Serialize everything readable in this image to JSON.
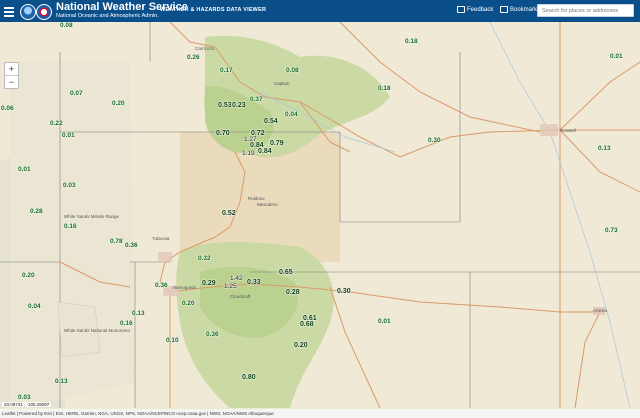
{
  "header": {
    "title": "National Weather Service",
    "subtitle": "National Oceanic and Atmospheric Admin.",
    "viewer_title": "WEATHER & HAZARDS DATA VIEWER",
    "feedback_label": "Feedback",
    "bookmark_label": "Bookmark",
    "search_placeholder": "Search for places or addresses"
  },
  "map": {
    "zoom_in": "+",
    "zoom_out": "−",
    "coordinates": "33.08731 , -105.29297",
    "attribution": "Leaflet | Powered by Esri | Esri, HERE, Garmin, NGA, USGS, NPS, NOAA/NCEP/NCO ncep.noaa.gov | NWS; NOAA/NWS Albuquerque",
    "place_labels": [
      "Carrizozo",
      "Capitan",
      "Roswell",
      "Ruidoso",
      "Mescalero",
      "White Sands Missile Range",
      "Tularosa",
      "Alamogordo",
      "White Sands National Monument",
      "Cloudcroft",
      "Artesia"
    ],
    "precip_values": [
      "0.08",
      "0.07",
      "0.06",
      "0.20",
      "0.22",
      "0.01",
      "0.17",
      "0.08",
      "0.18",
      "0.01",
      "0.26",
      "0.37",
      "0.53",
      "0.23",
      "0.54",
      "0.18",
      "0.04",
      "0.70",
      "0.72",
      "0.79",
      "0.84",
      "1.27",
      "1.19",
      "0.84",
      "0.01",
      "0.30",
      "0.13",
      "0.03",
      "0.28",
      "0.16",
      "0.78",
      "0.36",
      "0.73",
      "0.52",
      "0.32",
      "1.42",
      "1.25",
      "0.65",
      "0.20",
      "0.29",
      "0.33",
      "0.36",
      "0.30",
      "0.04",
      "0.28",
      "0.13",
      "0.16",
      "0.20",
      "0.61",
      "0.68",
      "0.01",
      "0.10",
      "0.36",
      "0.20",
      "0.03",
      "0.80",
      "0.13"
    ]
  },
  "colors": {
    "header_bg": "#0b4f8a",
    "value_green": "#136b1c",
    "forest_green": "#c7d8a0"
  }
}
